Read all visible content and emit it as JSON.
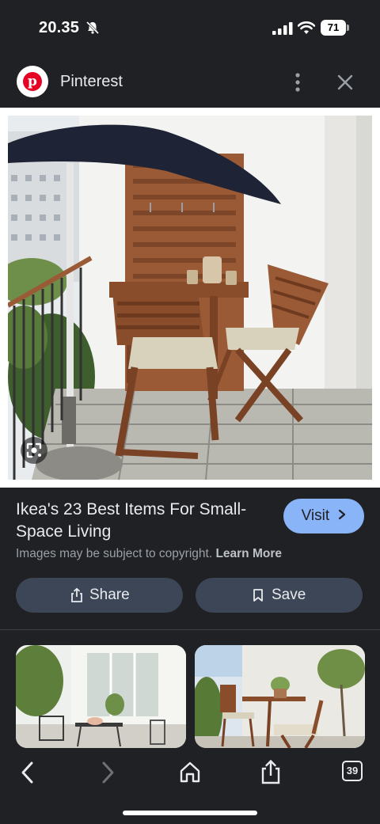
{
  "status_bar": {
    "time": "20.35",
    "battery": "71"
  },
  "source": {
    "logo_letter": "p",
    "name": "Pinterest"
  },
  "result": {
    "title": "Ikea's 23 Best Items For Small-Space Living",
    "visit_label": "Visit",
    "copyright_text": "Images may be subject to copyright.",
    "learn_more_label": "Learn More"
  },
  "actions": {
    "share_label": "Share",
    "save_label": "Save"
  },
  "bottom_nav": {
    "tabs_count": "39"
  },
  "colors": {
    "background": "#202124",
    "accent_visit": "#8ab4f8",
    "action_button": "#3c4656",
    "pinterest_red": "#e60023"
  },
  "icons": [
    "bell-muted-icon",
    "signal-icon",
    "wifi-icon",
    "battery-icon",
    "more-vert-icon",
    "close-icon",
    "lens-icon",
    "share-icon",
    "bookmark-icon",
    "back-icon",
    "forward-icon",
    "home-icon",
    "share-page-icon",
    "tabs-icon"
  ]
}
